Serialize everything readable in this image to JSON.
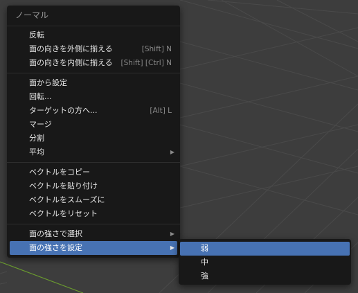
{
  "menu": {
    "title": "ノーマル",
    "groups": [
      {
        "items": [
          {
            "label": "反転",
            "shortcut": ""
          },
          {
            "label": "面の向きを外側に揃える",
            "shortcut": "[Shift] N"
          },
          {
            "label": "面の向きを内側に揃える",
            "shortcut": "[Shift] [Ctrl] N"
          }
        ]
      },
      {
        "items": [
          {
            "label": "面から設定",
            "shortcut": ""
          },
          {
            "label": "回転...",
            "shortcut": ""
          },
          {
            "label": "ターゲットの方へ...",
            "shortcut": "[Alt] L"
          },
          {
            "label": "マージ",
            "shortcut": ""
          },
          {
            "label": "分割",
            "shortcut": ""
          },
          {
            "label": "平均",
            "shortcut": "",
            "submenu": true
          }
        ]
      },
      {
        "items": [
          {
            "label": "ベクトルをコピー"
          },
          {
            "label": "ベクトルを貼り付け"
          },
          {
            "label": "ベクトルをスムーズに"
          },
          {
            "label": "ベクトルをリセット"
          }
        ]
      },
      {
        "items": [
          {
            "label": "面の強さで選択",
            "submenu": true
          },
          {
            "label": "面の強さを設定",
            "submenu": true,
            "active": true
          }
        ]
      }
    ],
    "submenu_arrow": "▶"
  },
  "submenu": {
    "items": [
      {
        "label": "弱",
        "active": true
      },
      {
        "label": "中"
      },
      {
        "label": "強"
      }
    ]
  },
  "colors": {
    "viewport_bg": "#3d3d3d",
    "grid_line": "#4a4a4a",
    "axis_green": "#6a9a2f",
    "menu_bg": "#181818",
    "highlight": "#4772b3"
  }
}
